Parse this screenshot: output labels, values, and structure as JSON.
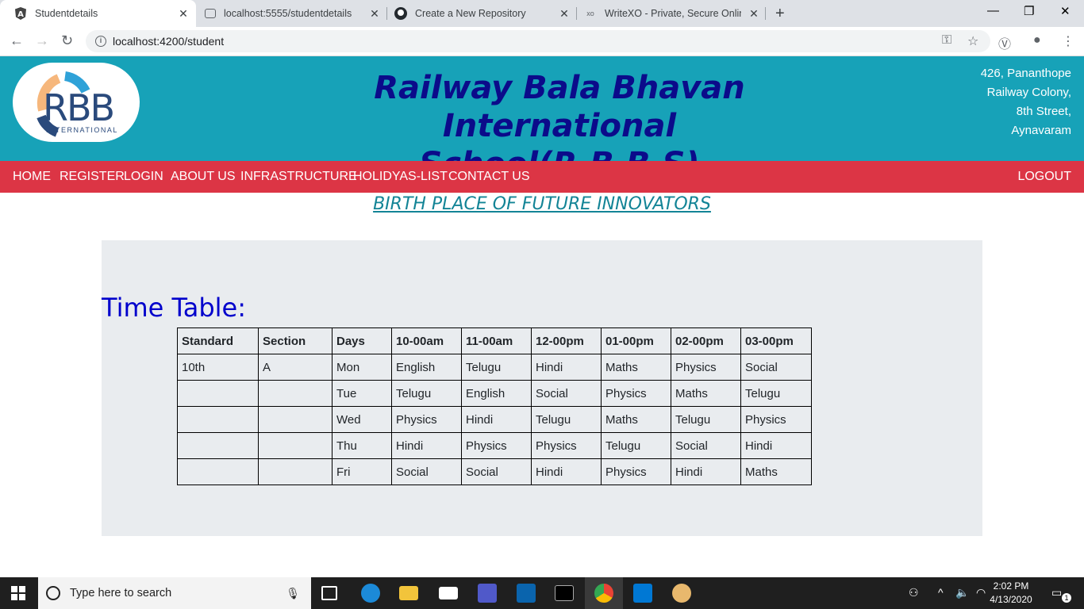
{
  "browser": {
    "tabs": [
      {
        "title": "Studentdetails",
        "favicon": "angular-icon",
        "active": true
      },
      {
        "title": "localhost:5555/studentdetails",
        "favicon": "page-icon",
        "active": false
      },
      {
        "title": "Create a New Repository",
        "favicon": "github-icon",
        "active": false
      },
      {
        "title": "WriteXO - Private, Secure Online",
        "favicon": "xo-icon",
        "active": false
      }
    ],
    "url": "localhost:4200/student"
  },
  "header": {
    "logo_text": "RBB",
    "logo_sub": "INTERNATIONAL",
    "title_line1": "Railway Bala Bhavan International",
    "title_line2": "School(R.B.B.S)",
    "address": [
      "426, Pananthope",
      "Railway Colony,",
      "8th Street,",
      "Aynavaram"
    ],
    "bg_color": "#17a2b8"
  },
  "nav": {
    "items": [
      "HOME",
      "REGISTER",
      "LOGIN",
      "ABOUT US",
      "INFRASTRUCTURE",
      "HOLIDYAS-LIST",
      "CONTACT US"
    ],
    "logout": "LOGOUT",
    "bg_color": "#dc3545"
  },
  "slogan": "BIRTH PLACE OF FUTURE INNOVATORS",
  "timetable": {
    "heading": "Time Table:",
    "columns": [
      "Standard",
      "Section",
      "Days",
      "10-00am",
      "11-00am",
      "12-00pm",
      "01-00pm",
      "02-00pm",
      "03-00pm"
    ],
    "rows": [
      [
        "10th",
        "A",
        "Mon",
        "English",
        "Telugu",
        "Hindi",
        "Maths",
        "Physics",
        "Social"
      ],
      [
        "",
        "",
        "Tue",
        "Telugu",
        "English",
        "Social",
        "Physics",
        "Maths",
        "Telugu"
      ],
      [
        "",
        "",
        "Wed",
        "Physics",
        "Hindi",
        "Telugu",
        "Maths",
        "Telugu",
        "Physics"
      ],
      [
        "",
        "",
        "Thu",
        "Hindi",
        "Physics",
        "Physics",
        "Telugu",
        "Social",
        "Hindi"
      ],
      [
        "",
        "",
        "Fri",
        "Social",
        "Social",
        "Hindi",
        "Physics",
        "Hindi",
        "Maths"
      ]
    ]
  },
  "taskbar": {
    "search_placeholder": "Type here to search",
    "time": "2:02 PM",
    "date": "4/13/2020",
    "notification_count": "1"
  }
}
